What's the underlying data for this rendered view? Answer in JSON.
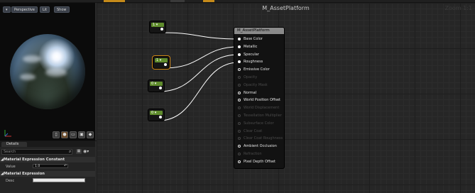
{
  "viewport": {
    "buttons": [
      "Perspective",
      "Lit",
      "Show"
    ]
  },
  "details": {
    "tab_label": "Details",
    "search_placeholder": "Search",
    "section1": "Material Expression Constant",
    "value_label": "Value",
    "value": "1.0",
    "section2": "Material Expression",
    "desc_label": "Desc"
  },
  "graph": {
    "title": "M_AssetPlatform",
    "zoom": "Zoom 1:1",
    "constants": [
      {
        "value": "1"
      },
      {
        "value": "1"
      },
      {
        "value": "0"
      },
      {
        "value": "0"
      }
    ]
  },
  "material_node": {
    "title": "M_AssetPlatform",
    "inputs": [
      {
        "label": "Base Color",
        "state": "connected"
      },
      {
        "label": "Metallic",
        "state": "connected"
      },
      {
        "label": "Specular",
        "state": "connected"
      },
      {
        "label": "Roughness",
        "state": "connected"
      },
      {
        "label": "Emissive Color",
        "state": "enabled"
      },
      {
        "label": "Opacity",
        "state": "disabled"
      },
      {
        "label": "Opacity Mask",
        "state": "disabled"
      },
      {
        "label": "Normal",
        "state": "enabled"
      },
      {
        "label": "World Position Offset",
        "state": "enabled"
      },
      {
        "label": "World Displacement",
        "state": "disabled"
      },
      {
        "label": "Tessellation Multiplier",
        "state": "disabled"
      },
      {
        "label": "Subsurface Color",
        "state": "disabled"
      },
      {
        "label": "Clear Coat",
        "state": "disabled"
      },
      {
        "label": "Clear Coat Roughness",
        "state": "disabled"
      },
      {
        "label": "Ambient Occlusion",
        "state": "enabled"
      },
      {
        "label": "Refraction",
        "state": "disabled"
      },
      {
        "label": "Pixel Depth Offset",
        "state": "enabled"
      }
    ]
  },
  "colors": {
    "constant_header": "#5f8c2c",
    "selection": "#d48b18",
    "wire": "#ffffff"
  }
}
